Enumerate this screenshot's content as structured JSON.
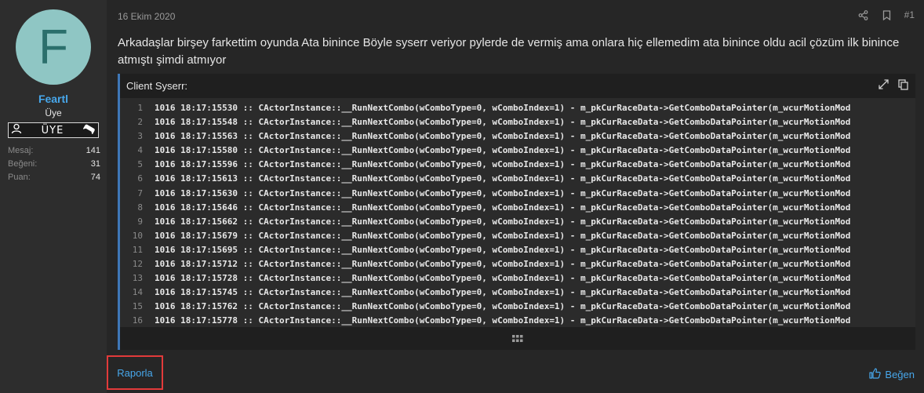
{
  "user": {
    "avatar_letter": "F",
    "name": "Feartl",
    "title": "Üye",
    "banner": "ÜYE",
    "stats": [
      {
        "label": "Mesaj:",
        "value": "141"
      },
      {
        "label": "Beğeni:",
        "value": "31"
      },
      {
        "label": "Puan:",
        "value": "74"
      }
    ]
  },
  "post": {
    "date": "16 Ekim 2020",
    "number": "#1",
    "text": "Arkadaşlar birşey farkettim oyunda Ata binince Böyle syserr veriyor pylerde de vermiş ama onlara hiç ellemedim ata binince oldu acil çözüm ilk binince atmıştı şimdi atmıyor",
    "code_title": "Client Syserr:",
    "code_lines": [
      {
        "n": "1",
        "t": "1016 18:17:15530 :: CActorInstance::__RunNextCombo(wComboType=0, wComboIndex=1) - m_pkCurRaceData->GetComboDataPointer(m_wcurMotionMod"
      },
      {
        "n": "2",
        "t": "1016 18:17:15548 :: CActorInstance::__RunNextCombo(wComboType=0, wComboIndex=1) - m_pkCurRaceData->GetComboDataPointer(m_wcurMotionMod"
      },
      {
        "n": "3",
        "t": "1016 18:17:15563 :: CActorInstance::__RunNextCombo(wComboType=0, wComboIndex=1) - m_pkCurRaceData->GetComboDataPointer(m_wcurMotionMod"
      },
      {
        "n": "4",
        "t": "1016 18:17:15580 :: CActorInstance::__RunNextCombo(wComboType=0, wComboIndex=1) - m_pkCurRaceData->GetComboDataPointer(m_wcurMotionMod"
      },
      {
        "n": "5",
        "t": "1016 18:17:15596 :: CActorInstance::__RunNextCombo(wComboType=0, wComboIndex=1) - m_pkCurRaceData->GetComboDataPointer(m_wcurMotionMod"
      },
      {
        "n": "6",
        "t": "1016 18:17:15613 :: CActorInstance::__RunNextCombo(wComboType=0, wComboIndex=1) - m_pkCurRaceData->GetComboDataPointer(m_wcurMotionMod"
      },
      {
        "n": "7",
        "t": "1016 18:17:15630 :: CActorInstance::__RunNextCombo(wComboType=0, wComboIndex=1) - m_pkCurRaceData->GetComboDataPointer(m_wcurMotionMod"
      },
      {
        "n": "8",
        "t": "1016 18:17:15646 :: CActorInstance::__RunNextCombo(wComboType=0, wComboIndex=1) - m_pkCurRaceData->GetComboDataPointer(m_wcurMotionMod"
      },
      {
        "n": "9",
        "t": "1016 18:17:15662 :: CActorInstance::__RunNextCombo(wComboType=0, wComboIndex=1) - m_pkCurRaceData->GetComboDataPointer(m_wcurMotionMod"
      },
      {
        "n": "10",
        "t": "1016 18:17:15679 :: CActorInstance::__RunNextCombo(wComboType=0, wComboIndex=1) - m_pkCurRaceData->GetComboDataPointer(m_wcurMotionMod"
      },
      {
        "n": "11",
        "t": "1016 18:17:15695 :: CActorInstance::__RunNextCombo(wComboType=0, wComboIndex=1) - m_pkCurRaceData->GetComboDataPointer(m_wcurMotionMod"
      },
      {
        "n": "12",
        "t": "1016 18:17:15712 :: CActorInstance::__RunNextCombo(wComboType=0, wComboIndex=1) - m_pkCurRaceData->GetComboDataPointer(m_wcurMotionMod"
      },
      {
        "n": "13",
        "t": "1016 18:17:15728 :: CActorInstance::__RunNextCombo(wComboType=0, wComboIndex=1) - m_pkCurRaceData->GetComboDataPointer(m_wcurMotionMod"
      },
      {
        "n": "14",
        "t": "1016 18:17:15745 :: CActorInstance::__RunNextCombo(wComboType=0, wComboIndex=1) - m_pkCurRaceData->GetComboDataPointer(m_wcurMotionMod"
      },
      {
        "n": "15",
        "t": "1016 18:17:15762 :: CActorInstance::__RunNextCombo(wComboType=0, wComboIndex=1) - m_pkCurRaceData->GetComboDataPointer(m_wcurMotionMod"
      },
      {
        "n": "16",
        "t": "1016 18:17:15778 :: CActorInstance::__RunNextCombo(wComboType=0, wComboIndex=1) - m_pkCurRaceData->GetComboDataPointer(m_wcurMotionMod"
      }
    ]
  },
  "footer": {
    "report_label": "Raporla",
    "like_label": "Beğen"
  },
  "icons": {
    "share": "share-icon",
    "bookmark": "bookmark-icon",
    "expand": "expand-icon",
    "copy": "copy-icon",
    "expand_code": "grid-icon",
    "like": "thumbs-up-icon",
    "banner_left": "user-icon",
    "banner_right": "gamepad-icon"
  },
  "colors": {
    "link": "#47a7eb",
    "avatar_bg": "#8fc6c4",
    "avatar_letter": "#2b6f6c",
    "code_border": "#3f77b8",
    "report_highlight": "#e23a3a"
  }
}
